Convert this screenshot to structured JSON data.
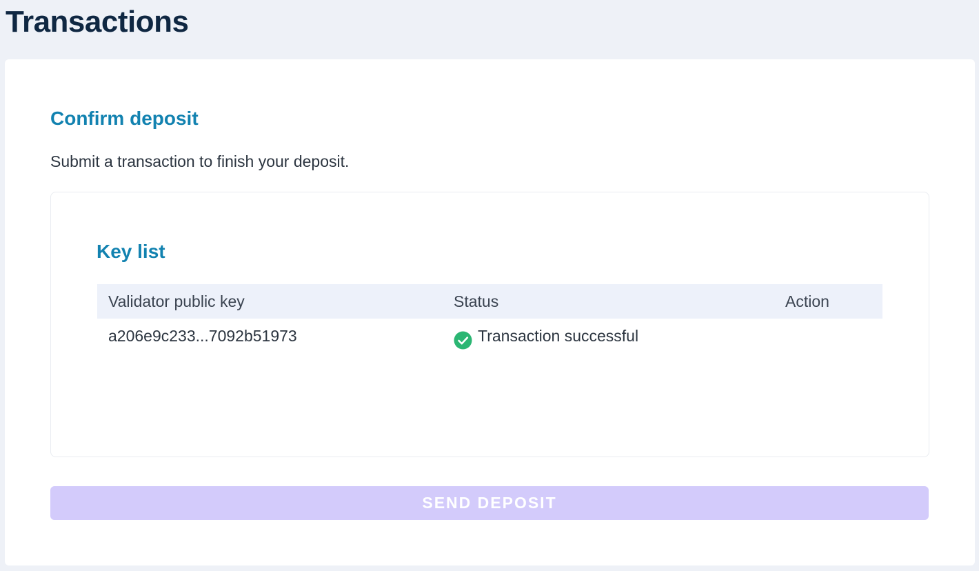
{
  "page": {
    "title": "Transactions"
  },
  "deposit": {
    "heading": "Confirm deposit",
    "description": "Submit a transaction to finish your deposit."
  },
  "key_list": {
    "title": "Key list",
    "columns": {
      "key": "Validator public key",
      "status": "Status",
      "action": "Action"
    },
    "rows": [
      {
        "key": "a206e9c233...7092b51973",
        "status": "Transaction successful",
        "status_icon": "check-circle-icon",
        "action": ""
      }
    ]
  },
  "actions": {
    "send_deposit_label": "SEND DEPOSIT",
    "send_deposit_enabled": false
  },
  "colors": {
    "heading_accent": "#1282b0",
    "success": "#2bb673",
    "button_disabled": "#d3cbfb",
    "background": "#eef1f7"
  }
}
